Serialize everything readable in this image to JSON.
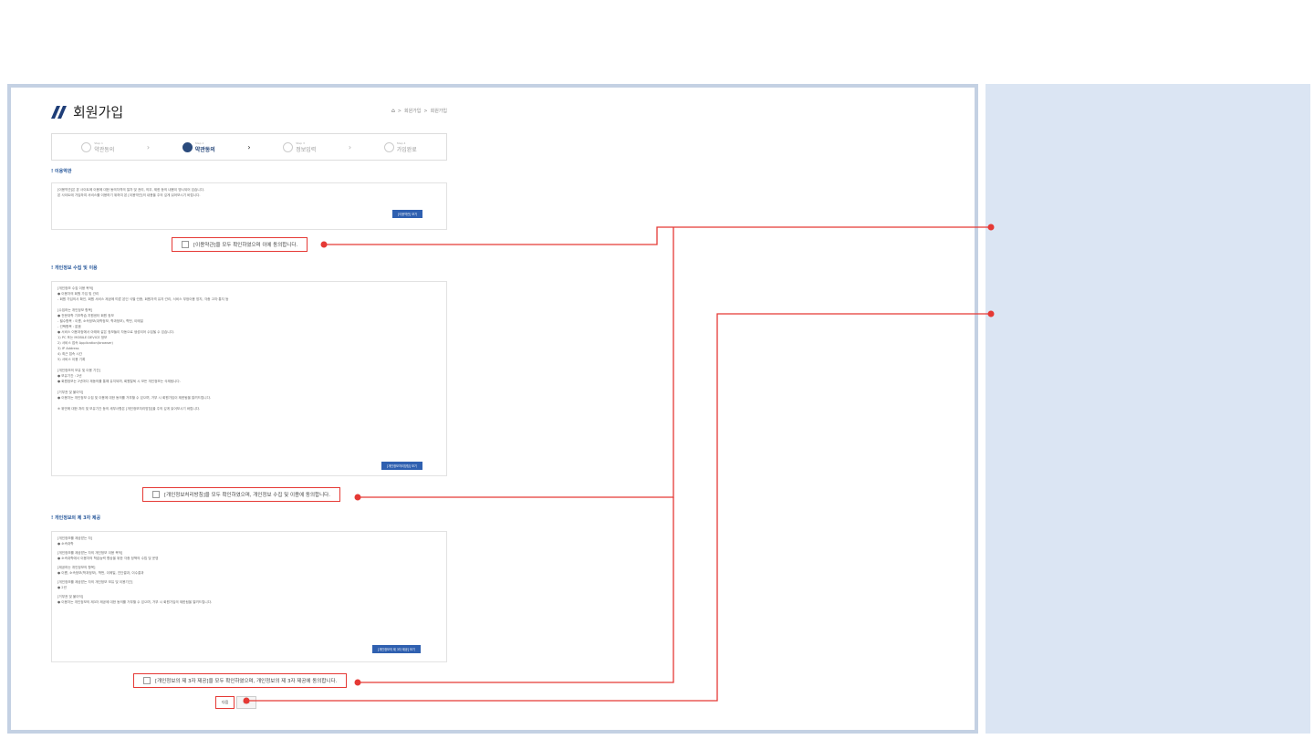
{
  "header": {
    "title": "회원가입",
    "breadcrumb": [
      "회원가입",
      "회원가입"
    ]
  },
  "steps": [
    {
      "num": "Step 1",
      "label": "약관동의"
    },
    {
      "num": "Step 2",
      "label": "약관동의"
    },
    {
      "num": "Step 3",
      "label": "정보입력"
    },
    {
      "num": "Step 4",
      "label": "가입완료"
    }
  ],
  "terms": {
    "title": "이용약관",
    "lines": [
      "[이용약관]은 본 사이트에 이용에 대한 동의자격의 절차 및 권리, 의무, 제한 등의 내용이 명시되어 있습니다.",
      "본 사이트에 가입하여 서비스를 이용하기 위하여 본 [이용약관]의 내용을 주의 깊게 읽어보시기 바랍니다."
    ],
    "view_button": "[이용약관] 보기",
    "agree_label": "[이용약관]을 모두 확인하였으며 이에 동의합니다."
  },
  "privacy": {
    "title": "개인정보 수집 및 이용",
    "paragraphs": [
      "[개인정보 수집 이용 목적]",
      "● 이용자의 회원 가입 및 관리",
      "- 회원 가입의사 확인, 회원 서비스 제공에 따른 본인 식별·인증, 회원자격 유지·관리, 서비스 부정이용 방지, 각종 고지·통지 등",
      "[수집하는 개인정보 항목]",
      "● 전문대학 기초학습 지원센터 회원 정보",
      "- 필수항목 : 이름, 소속정보(대학정보, 학과정보), 학번, 이메일",
      "- 선택항목 : 없음",
      "● 서비스 이용과정에서 아래와 같은 정보들이 자동으로 생성되어 수집될 수 있습니다.",
      "1) PC 또는 MOBILE DEVICE 정보",
      "2) 서비스 접속 Application(browser)",
      "3) IP Address",
      "4) 최근 접속 시간",
      "5) 서비스 이용 기록",
      "[개인정보의 보유 및 이용 기간]",
      "● 보유기간 : 2년",
      "● 회원정보는 2년마다 재동의를 통해 유지되며, 회원탈퇴 시 모든 개인정보는 삭제됩니다.",
      "[거부권 및 불이익]",
      "● 이용자는 개인정보 수집 및 이용에 대한 동의를 거부할 수 있으며, 거부 시 회원가입이 제한됨을 알려드립니다.",
      "※ 위반에 대한 처리 및 보유기간 등의 세부사항은 [개인정보처리방침]을 주의 깊게 읽어보시기 바랍니다."
    ],
    "view_button": "[개인정보처리방침] 보기",
    "agree_label": "[개인정보처리방침]을 모두 확인하였으며, 개인정보 수집 및 이용에 동의합니다."
  },
  "third_party": {
    "title": "개인정보의 제 3자 제공",
    "paragraphs": [
      "[개인정보를 제공받는 자]",
      "● 소속대학",
      "[개인정보를 제공받는 자의 개인정보 이용 목적]",
      "● 소속대학에서 이용자의 학습능력 향상을 위한 각종 정책의 수립 및 운영",
      "[제공하는 개인정보의 항목]",
      "● 이름, 소속정보(학과정보), 학번, 이메일, 진단결과, 이수결과",
      "[개인정보를 제공받는 자의 개인정보 보유 및 이용기간]",
      "● 2년",
      "[거부권 및 불이익]",
      "● 이용자는 개인정보의 제3자 제공에 대한 동의를 거부할 수 있으며, 거부 시 회원가입의 제한됨을 알려드립니다."
    ],
    "view_button": "[개인정보의 제 3자 제공] 보기",
    "agree_label": "[개인정보의 제 3자 제공]을 모두 확인하였으며, 개인정보의 제 3자 제공에 동의합니다."
  },
  "actions": {
    "next": "다음",
    "cancel": "취소"
  },
  "annotation_color": "#e53935"
}
